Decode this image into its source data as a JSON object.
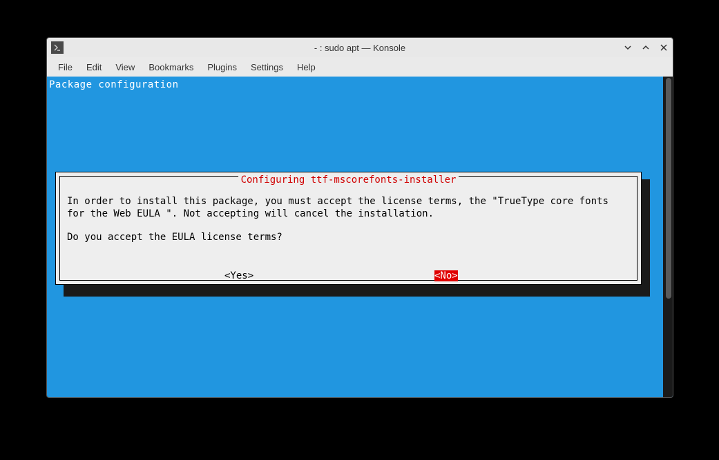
{
  "window": {
    "title": "- : sudo apt — Konsole"
  },
  "menubar": {
    "items": [
      "File",
      "Edit",
      "View",
      "Bookmarks",
      "Plugins",
      "Settings",
      "Help"
    ]
  },
  "terminal": {
    "header": "Package configuration"
  },
  "dialog": {
    "title": " Configuring ttf-mscorefonts-installer ",
    "text1": "In order to install this package, you must accept the license terms, the \"TrueType core fonts for the Web EULA \". Not accepting will cancel the installation.",
    "text2": "Do you accept the EULA license terms?",
    "yes": "<Yes>",
    "no": "<No>"
  }
}
